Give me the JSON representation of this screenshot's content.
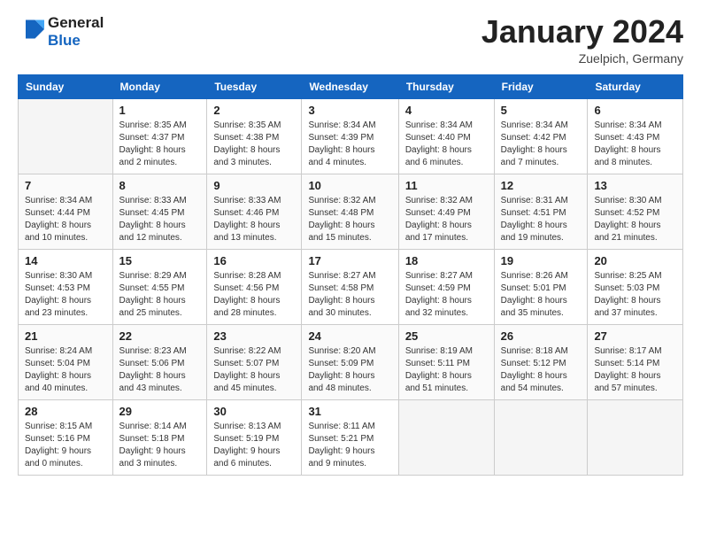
{
  "header": {
    "logo_line1": "General",
    "logo_line2": "Blue",
    "month_title": "January 2024",
    "location": "Zuelpich, Germany"
  },
  "days_of_week": [
    "Sunday",
    "Monday",
    "Tuesday",
    "Wednesday",
    "Thursday",
    "Friday",
    "Saturday"
  ],
  "weeks": [
    [
      {
        "day": "",
        "info": ""
      },
      {
        "day": "1",
        "info": "Sunrise: 8:35 AM\nSunset: 4:37 PM\nDaylight: 8 hours\nand 2 minutes."
      },
      {
        "day": "2",
        "info": "Sunrise: 8:35 AM\nSunset: 4:38 PM\nDaylight: 8 hours\nand 3 minutes."
      },
      {
        "day": "3",
        "info": "Sunrise: 8:34 AM\nSunset: 4:39 PM\nDaylight: 8 hours\nand 4 minutes."
      },
      {
        "day": "4",
        "info": "Sunrise: 8:34 AM\nSunset: 4:40 PM\nDaylight: 8 hours\nand 6 minutes."
      },
      {
        "day": "5",
        "info": "Sunrise: 8:34 AM\nSunset: 4:42 PM\nDaylight: 8 hours\nand 7 minutes."
      },
      {
        "day": "6",
        "info": "Sunrise: 8:34 AM\nSunset: 4:43 PM\nDaylight: 8 hours\nand 8 minutes."
      }
    ],
    [
      {
        "day": "7",
        "info": "Sunrise: 8:34 AM\nSunset: 4:44 PM\nDaylight: 8 hours\nand 10 minutes."
      },
      {
        "day": "8",
        "info": "Sunrise: 8:33 AM\nSunset: 4:45 PM\nDaylight: 8 hours\nand 12 minutes."
      },
      {
        "day": "9",
        "info": "Sunrise: 8:33 AM\nSunset: 4:46 PM\nDaylight: 8 hours\nand 13 minutes."
      },
      {
        "day": "10",
        "info": "Sunrise: 8:32 AM\nSunset: 4:48 PM\nDaylight: 8 hours\nand 15 minutes."
      },
      {
        "day": "11",
        "info": "Sunrise: 8:32 AM\nSunset: 4:49 PM\nDaylight: 8 hours\nand 17 minutes."
      },
      {
        "day": "12",
        "info": "Sunrise: 8:31 AM\nSunset: 4:51 PM\nDaylight: 8 hours\nand 19 minutes."
      },
      {
        "day": "13",
        "info": "Sunrise: 8:30 AM\nSunset: 4:52 PM\nDaylight: 8 hours\nand 21 minutes."
      }
    ],
    [
      {
        "day": "14",
        "info": "Sunrise: 8:30 AM\nSunset: 4:53 PM\nDaylight: 8 hours\nand 23 minutes."
      },
      {
        "day": "15",
        "info": "Sunrise: 8:29 AM\nSunset: 4:55 PM\nDaylight: 8 hours\nand 25 minutes."
      },
      {
        "day": "16",
        "info": "Sunrise: 8:28 AM\nSunset: 4:56 PM\nDaylight: 8 hours\nand 28 minutes."
      },
      {
        "day": "17",
        "info": "Sunrise: 8:27 AM\nSunset: 4:58 PM\nDaylight: 8 hours\nand 30 minutes."
      },
      {
        "day": "18",
        "info": "Sunrise: 8:27 AM\nSunset: 4:59 PM\nDaylight: 8 hours\nand 32 minutes."
      },
      {
        "day": "19",
        "info": "Sunrise: 8:26 AM\nSunset: 5:01 PM\nDaylight: 8 hours\nand 35 minutes."
      },
      {
        "day": "20",
        "info": "Sunrise: 8:25 AM\nSunset: 5:03 PM\nDaylight: 8 hours\nand 37 minutes."
      }
    ],
    [
      {
        "day": "21",
        "info": "Sunrise: 8:24 AM\nSunset: 5:04 PM\nDaylight: 8 hours\nand 40 minutes."
      },
      {
        "day": "22",
        "info": "Sunrise: 8:23 AM\nSunset: 5:06 PM\nDaylight: 8 hours\nand 43 minutes."
      },
      {
        "day": "23",
        "info": "Sunrise: 8:22 AM\nSunset: 5:07 PM\nDaylight: 8 hours\nand 45 minutes."
      },
      {
        "day": "24",
        "info": "Sunrise: 8:20 AM\nSunset: 5:09 PM\nDaylight: 8 hours\nand 48 minutes."
      },
      {
        "day": "25",
        "info": "Sunrise: 8:19 AM\nSunset: 5:11 PM\nDaylight: 8 hours\nand 51 minutes."
      },
      {
        "day": "26",
        "info": "Sunrise: 8:18 AM\nSunset: 5:12 PM\nDaylight: 8 hours\nand 54 minutes."
      },
      {
        "day": "27",
        "info": "Sunrise: 8:17 AM\nSunset: 5:14 PM\nDaylight: 8 hours\nand 57 minutes."
      }
    ],
    [
      {
        "day": "28",
        "info": "Sunrise: 8:15 AM\nSunset: 5:16 PM\nDaylight: 9 hours\nand 0 minutes."
      },
      {
        "day": "29",
        "info": "Sunrise: 8:14 AM\nSunset: 5:18 PM\nDaylight: 9 hours\nand 3 minutes."
      },
      {
        "day": "30",
        "info": "Sunrise: 8:13 AM\nSunset: 5:19 PM\nDaylight: 9 hours\nand 6 minutes."
      },
      {
        "day": "31",
        "info": "Sunrise: 8:11 AM\nSunset: 5:21 PM\nDaylight: 9 hours\nand 9 minutes."
      },
      {
        "day": "",
        "info": ""
      },
      {
        "day": "",
        "info": ""
      },
      {
        "day": "",
        "info": ""
      }
    ]
  ]
}
